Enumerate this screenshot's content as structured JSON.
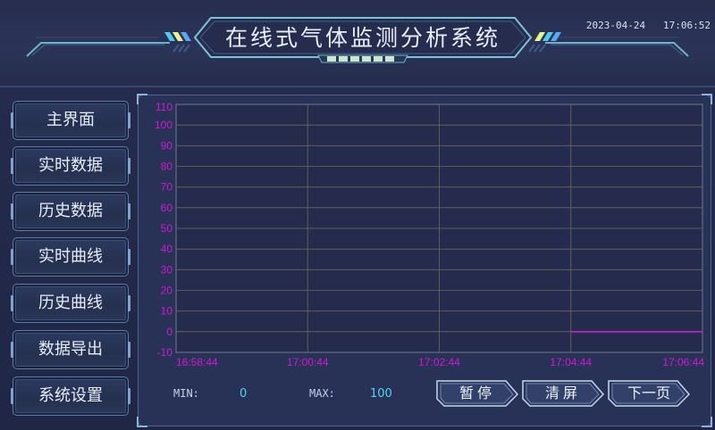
{
  "header": {
    "title": "在线式气体监测分析系统",
    "date": "2023-04-24",
    "time": "17:06:52"
  },
  "sidebar": {
    "items": [
      {
        "label": "主界面"
      },
      {
        "label": "实时数据"
      },
      {
        "label": "历史数据"
      },
      {
        "label": "实时曲线"
      },
      {
        "label": "历史曲线"
      },
      {
        "label": "数据导出"
      },
      {
        "label": "系统设置"
      }
    ]
  },
  "stats": {
    "min_label": "MIN:",
    "min_value": "0",
    "max_label": "MAX:",
    "max_value": "100"
  },
  "actions": {
    "pause": "暂停",
    "clear": "清屏",
    "next_page": "下一页"
  },
  "colors": {
    "axis_text": "#d01ad0",
    "series": "#d020d0",
    "accent": "#4fd8f0"
  },
  "chart_data": {
    "type": "line",
    "x_labels": [
      "16:58:44",
      "17:00:44",
      "17:02:44",
      "17:04:44",
      "17:06:44"
    ],
    "y_ticks": [
      110,
      100,
      90,
      80,
      70,
      60,
      50,
      40,
      30,
      20,
      10,
      0,
      -10
    ],
    "ylim": [
      -10,
      110
    ],
    "grid": true,
    "series": [
      {
        "x": [
          "17:04:44",
          "17:06:44"
        ],
        "values": [
          0,
          0
        ]
      }
    ]
  }
}
